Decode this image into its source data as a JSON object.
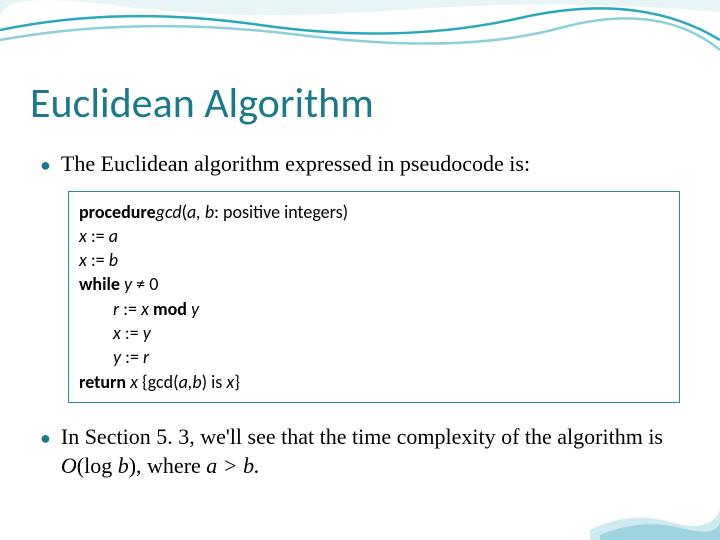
{
  "title": "Euclidean Algorithm",
  "bullet1": "The Euclidean algorithm expressed in pseudocode is:",
  "code": {
    "l1a": "procedure",
    "l1b": "gcd",
    "l1c": "(",
    "l1d": "a, b",
    "l1e": ": positive integers)",
    "l2a": "x",
    "l2b": " := ",
    "l2c": "a",
    "l3a": "x",
    "l3b": " := ",
    "l3c": "b",
    "l4a": "while",
    "l4b": "   y ",
    "l4c": "≠",
    "l4d": " 0",
    "l5a": "r",
    "l5b": " := ",
    "l5c": "x ",
    "l5d": "mod",
    "l5e": " y",
    "l6a": "x",
    "l6b": " := ",
    "l6c": "y",
    "l7a": "y",
    "l7b": " := ",
    "l7c": "r",
    "l8a": "return",
    "l8b": " x ",
    "l8c": "{gcd(",
    "l8d": "a,b",
    "l8e": ") is ",
    "l8f": "x",
    "l8g": "}"
  },
  "bullet2_a": "In Section ",
  "bullet2_b": "5. 3",
  "bullet2_c": ", we'll see that the time complexity of the algorithm is ",
  "bullet2_d": "O",
  "bullet2_e": "(log ",
  "bullet2_f": "b",
  "bullet2_g": "), where ",
  "bullet2_h": "a > b.",
  "bullet_char": "●"
}
